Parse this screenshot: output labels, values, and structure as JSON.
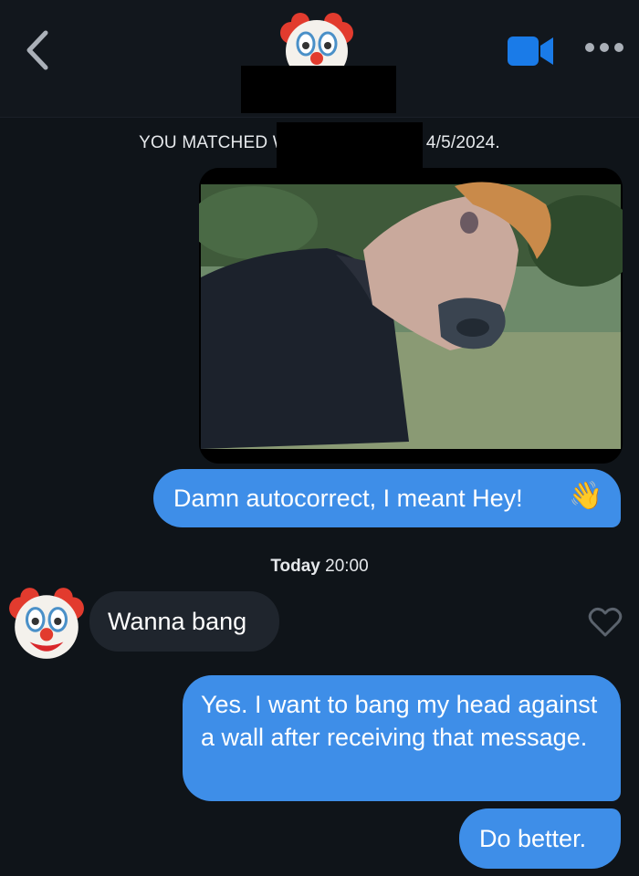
{
  "header": {
    "back_icon": "chevron-left-icon",
    "avatar_icon": "clown-face-icon",
    "video_icon": "video-camera-icon",
    "more_icon": "more-dots-icon",
    "accent": "#1a7be8"
  },
  "match_banner": {
    "prefix": "YOU MATCHED W",
    "date": "4/5/2024."
  },
  "messages": [
    {
      "direction": "outgoing",
      "type": "image",
      "description_icon": "horse-mask-photo"
    },
    {
      "direction": "outgoing",
      "text": "Damn autocorrect, I meant Hey!",
      "emoji": "👋"
    },
    {
      "direction": "incoming",
      "text": "Wanna bang"
    },
    {
      "direction": "outgoing",
      "text": "Yes. I want to bang my head against a wall after receiving that message."
    },
    {
      "direction": "outgoing",
      "text": "Do better."
    }
  ],
  "timestamp": {
    "day": "Today",
    "time": "20:00"
  },
  "colors": {
    "background": "#0f1419",
    "outgoing_bubble": "#3e8ee8",
    "incoming_bubble": "#1f252d"
  }
}
